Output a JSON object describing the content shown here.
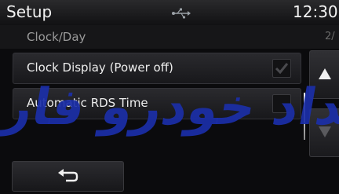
{
  "header": {
    "title": "Setup",
    "time": "12:30",
    "icons": [
      "usb-icon"
    ]
  },
  "subheader": {
    "title": "Clock/Day",
    "page_indicator": "2/"
  },
  "options": [
    {
      "label": "Clock Display (Power off)",
      "checked": true
    },
    {
      "label": "Automatic RDS Time",
      "checked": false
    }
  ],
  "scroll": {
    "up_icon": "triangle-up-icon",
    "down_icon": "triangle-down-icon"
  },
  "footer": {
    "back_icon": "return-arrow-icon"
  },
  "watermark": {
    "text": "مداد خودرو فارسا",
    "color": "#1b2fa8"
  },
  "colors": {
    "accent": "#1b2fa8",
    "text": "#e9e9e9",
    "background": "#0b0b0d"
  }
}
